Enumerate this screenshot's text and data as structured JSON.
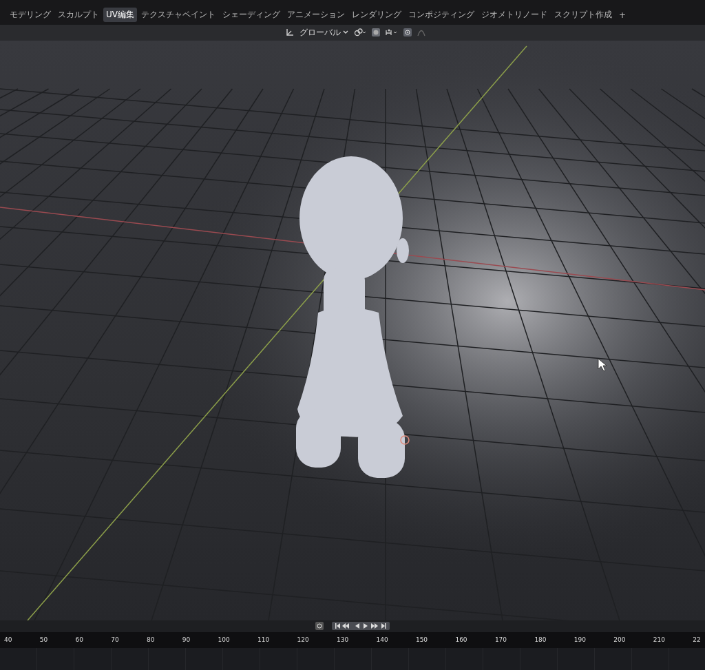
{
  "workspace_tabs": [
    {
      "label": "モデリング",
      "selected": false
    },
    {
      "label": "スカルプト",
      "selected": false
    },
    {
      "label": "UV編集",
      "selected": true
    },
    {
      "label": "テクスチャペイント",
      "selected": false
    },
    {
      "label": "シェーディング",
      "selected": false
    },
    {
      "label": "アニメーション",
      "selected": false
    },
    {
      "label": "レンダリング",
      "selected": false
    },
    {
      "label": "コンポジティング",
      "selected": false
    },
    {
      "label": "ジオメトリノード",
      "selected": false
    },
    {
      "label": "スクリプト作成",
      "selected": false
    }
  ],
  "add_tab": "+",
  "header": {
    "orientation": "グローバル"
  },
  "timeline": {
    "frames": [
      "40",
      "50",
      "60",
      "70",
      "80",
      "90",
      "100",
      "110",
      "120",
      "130",
      "140",
      "150",
      "160",
      "170",
      "180",
      "190",
      "200",
      "210",
      "22"
    ]
  }
}
